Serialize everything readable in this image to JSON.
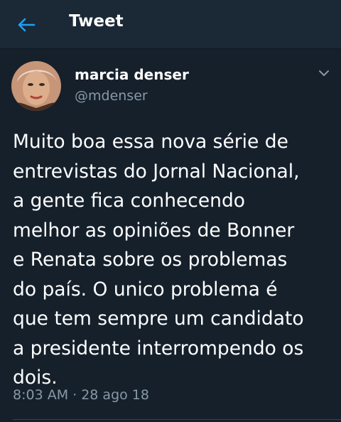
{
  "header": {
    "back_icon": "arrow-left-icon",
    "title": "Tweet"
  },
  "colors": {
    "background": "#15202b",
    "header_background": "#1b2836",
    "accent": "#1da1f2",
    "secondary_text": "#8899a6"
  },
  "tweet": {
    "author_name": "marcia denser",
    "author_handle": "@mdenser",
    "menu_icon": "chevron-down-icon",
    "text_lines": [
      "Muito boa essa nova série de",
      "entrevistas do Jornal Nacional,",
      "a gente fica conhecendo",
      "melhor as opiniões de Bonner",
      "e Renata sobre os problemas",
      "do país. O unico problema é",
      "que tem sempre um candidato",
      "a presidente interrompendo os",
      "dois."
    ],
    "timestamp": "8:03 AM · 28 ago 18"
  }
}
